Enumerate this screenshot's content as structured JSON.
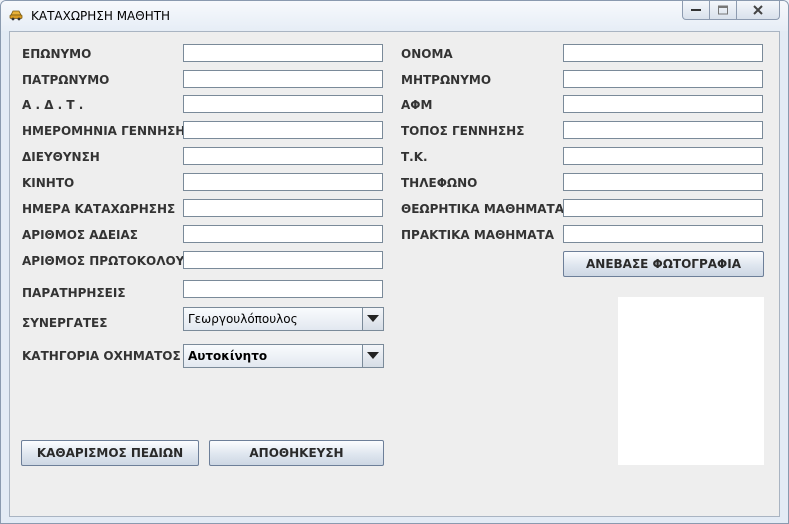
{
  "window": {
    "title": "ΚΑΤΑΧΩΡΗΣΗ ΜΑΘΗΤΗ"
  },
  "form": {
    "left_fields": [
      {
        "label": "ΕΠΩΝΥΜΟ",
        "value": ""
      },
      {
        "label": "ΠΑΤΡΩΝΥΜΟ",
        "value": ""
      },
      {
        "label": "Α . Δ . Τ .",
        "value": ""
      },
      {
        "label": "ΗΜΕΡΟΜΗΝΙΑ ΓΕΝΝΗΣΗΣ",
        "value": ""
      },
      {
        "label": "ΔΙΕΥΘΥΝΣΗ",
        "value": ""
      },
      {
        "label": "ΚΙΝΗΤΟ",
        "value": ""
      },
      {
        "label": "ΗΜΕΡΑ ΚΑΤΑΧΩΡΗΣΗΣ",
        "value": ""
      },
      {
        "label": "ΑΡΙΘΜΟΣ ΑΔΕΙΑΣ",
        "value": ""
      },
      {
        "label": "ΑΡΙΘΜΟΣ ΠΡΩΤΟΚΟΛΟΥ",
        "value": ""
      },
      {
        "label": "ΠΑΡΑΤΗΡΗΣΕΙΣ",
        "value": ""
      }
    ],
    "right_fields": [
      {
        "label": "ΟΝΟΜΑ",
        "value": ""
      },
      {
        "label": "ΜΗΤΡΩΝΥΜΟ",
        "value": ""
      },
      {
        "label": "ΑΦΜ",
        "value": ""
      },
      {
        "label": "ΤΟΠΟΣ ΓΕΝΝΗΣΗΣ",
        "value": ""
      },
      {
        "label": "Τ.Κ.",
        "value": ""
      },
      {
        "label": "ΤΗΛΕΦΩΝΟ",
        "value": ""
      },
      {
        "label": "ΘΕΩΡΗΤΙΚΑ ΜΑΘΗΜΑΤΑ",
        "value": ""
      },
      {
        "label": "ΠΡΑΚΤΙΚΑ ΜΑΘΗΜΑΤΑ",
        "value": ""
      }
    ],
    "partners": {
      "label": "ΣΥΝΕΡΓΑΤΕΣ",
      "selected": "Γεωργουλόπουλος"
    },
    "vehicle_category": {
      "label": "ΚΑΤΗΓΟΡΙΑ ΟΧΗΜΑΤΟΣ",
      "selected": "Αυτοκίνητο"
    }
  },
  "buttons": {
    "upload_photo": "ΑΝΕΒΑΣΕ ΦΩΤΟΓΡΑΦΙΑ",
    "clear_fields": "ΚΑΘΑΡΙΣΜΟΣ ΠΕΔΙΩΝ",
    "save": "ΑΠΟΘΗΚΕΥΣΗ"
  },
  "icons": {
    "app": "car-icon",
    "minimize": "minimize-icon",
    "maximize": "maximize-icon",
    "close": "close-icon",
    "dropdown": "chevron-down-icon"
  }
}
